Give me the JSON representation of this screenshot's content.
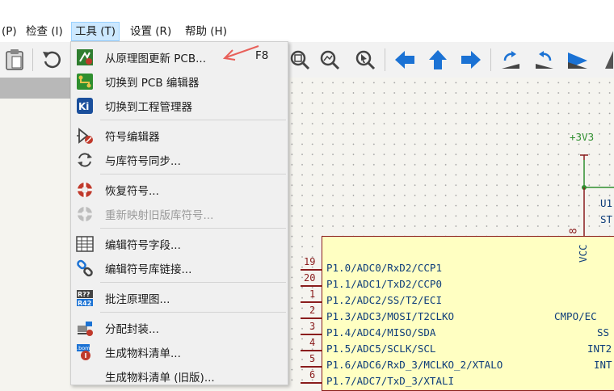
{
  "menubar": {
    "items": [
      "(P)",
      "检查 (I)",
      "工具 (T)",
      "设置 (R)",
      "帮助 (H)"
    ]
  },
  "menu": {
    "items": [
      {
        "label": "从原理图更新 PCB...",
        "shortcut": "F8",
        "icon": "update-pcb-icon"
      },
      {
        "label": "切换到 PCB 编辑器",
        "icon": "pcb-editor-icon"
      },
      {
        "label": "切换到工程管理器",
        "icon": "kicad-icon"
      },
      {
        "label": "符号编辑器",
        "icon": "symbol-editor-icon"
      },
      {
        "label": "与库符号同步...",
        "icon": "sync-icon"
      },
      {
        "label": "恢复符号...",
        "icon": "rescue-icon"
      },
      {
        "label": "重新映射旧版库符号...",
        "icon": "remap-icon",
        "disabled": true
      },
      {
        "label": "编辑符号字段...",
        "icon": "table-icon"
      },
      {
        "label": "编辑符号库链接...",
        "icon": "link-icon"
      },
      {
        "label": "批注原理图...",
        "icon": "annotate-icon"
      },
      {
        "label": "分配封装...",
        "icon": "footprint-icon"
      },
      {
        "label": "生成物料清单...",
        "icon": "bom-icon"
      },
      {
        "label": "生成物料清单 (旧版)...",
        "icon": "none"
      }
    ]
  },
  "schematic": {
    "power_label": "+3V3",
    "ref_label": "U1",
    "value_label": "ST",
    "vcc_label": "VCC",
    "vcc_pin": "8",
    "left_pins": [
      {
        "num": "19",
        "name": "P1.0/ADC0/RxD2/CCP1"
      },
      {
        "num": "20",
        "name": "P1.1/ADC1/TxD2/CCP0"
      },
      {
        "num": "1",
        "name": "P1.2/ADC2/SS/T2/ECI"
      },
      {
        "num": "2",
        "name": "P1.3/ADC3/MOSI/T2CLKO"
      },
      {
        "num": "3",
        "name": "P1.4/ADC4/MISO/SDA"
      },
      {
        "num": "4",
        "name": "P1.5/ADC5/SCLK/SCL"
      },
      {
        "num": "5",
        "name": "P1.6/ADC6/RxD_3/MCLKO_2/XTALO"
      },
      {
        "num": "6",
        "name": "P1.7/ADC7/TxD_3/XTALI"
      }
    ],
    "right_pins": [
      "CMPO/EC",
      "SS",
      "INT2",
      "INT"
    ]
  },
  "colors": {
    "accent": "#1b72d4",
    "pin": "#8a1d1d",
    "text": "#0e3d7a",
    "wire": "#2f8f2f"
  }
}
